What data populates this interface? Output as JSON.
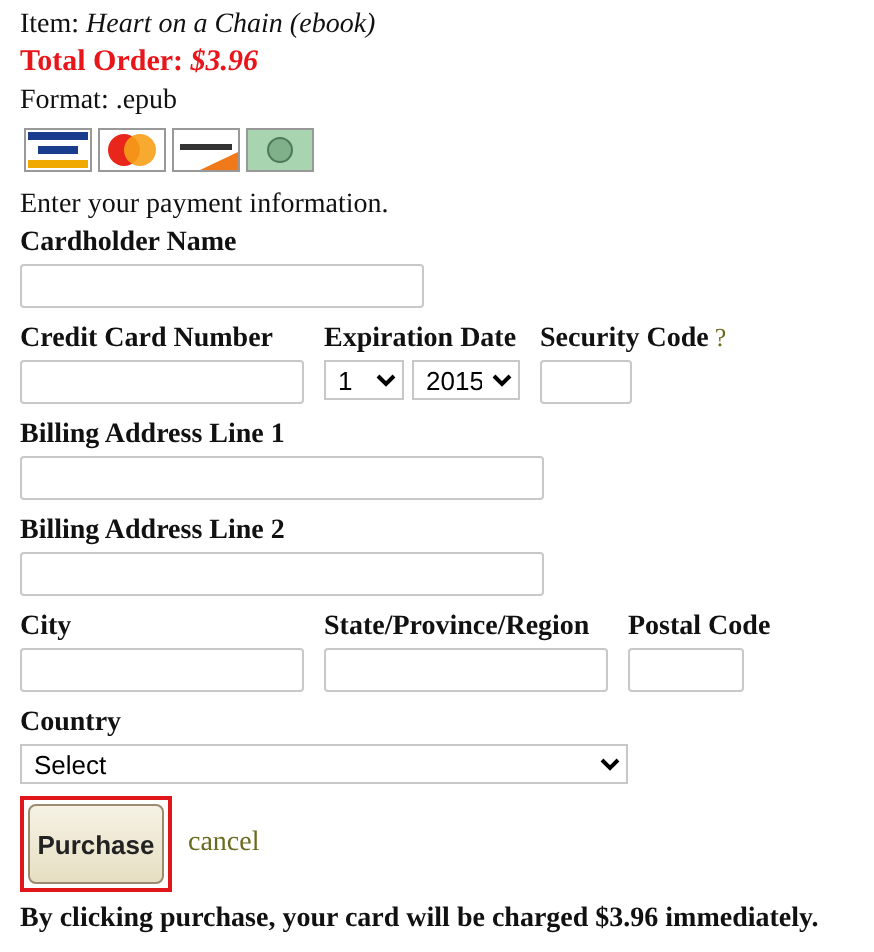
{
  "order": {
    "item": "Item: *Heart on a Chain (ebook)*",
    "total": "Total Order: *$3.96*",
    "format": "Format: .epub"
  },
  "intro": "Enter your payment information.",
  "rows": [
    [
      {
        "label": "Cardholder Name",
        "kind": "text"
      }
    ],
    [
      {
        "label": "Credit Card Number",
        "kind": "text"
      },
      {
        "label": "Expiration Date",
        "kind": "selects",
        "selects": [
          {
            "value": "1"
          },
          {
            "value": "2015"
          }
        ]
      },
      {
        "label": "Security Code",
        "kind": "text",
        "help": "?"
      }
    ],
    [
      {
        "label": "Billing Address Line 1",
        "kind": "text"
      }
    ],
    [
      {
        "label": "Billing Address Line 2",
        "kind": "text"
      }
    ],
    [
      {
        "label": "City",
        "kind": "text"
      },
      {
        "label": "State/Province/Region",
        "kind": "text"
      },
      {
        "label": "Postal Code",
        "kind": "text"
      }
    ],
    [
      {
        "label": "Country",
        "kind": "select",
        "value": "Select"
      }
    ]
  ],
  "purchase": {
    "label": "Purchase",
    "focused": true
  },
  "cancel": "cancel",
  "notice": "By clicking purchase, your card will be charged $3.96 immediately."
}
